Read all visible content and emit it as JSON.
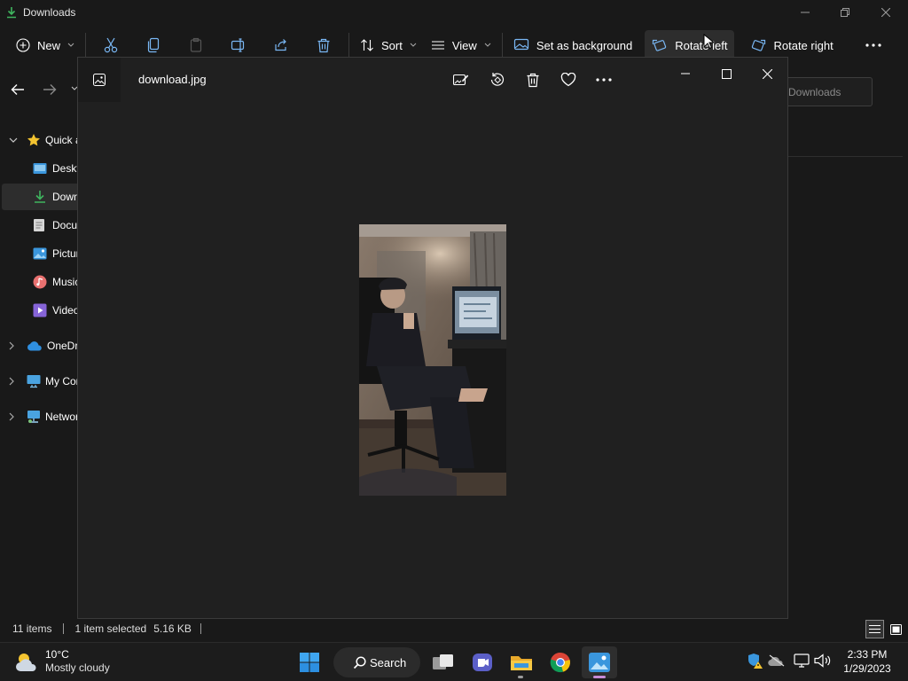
{
  "explorer": {
    "window_title": "Downloads",
    "toolbar": {
      "new_label": "New",
      "sort_label": "Sort",
      "view_label": "View",
      "set_background_label": "Set as background",
      "rotate_left_label": "Rotate left",
      "rotate_right_label": "Rotate right"
    },
    "sidebar": {
      "items": [
        {
          "label": "Quick access",
          "icon": "star-icon"
        },
        {
          "label": "Desktop",
          "icon": "desktop-folder-icon"
        },
        {
          "label": "Downloads",
          "icon": "download-arrow-icon"
        },
        {
          "label": "Documents",
          "icon": "document-icon"
        },
        {
          "label": "Pictures",
          "icon": "pictures-icon"
        },
        {
          "label": "Music",
          "icon": "music-icon"
        },
        {
          "label": "Videos",
          "icon": "videos-icon"
        },
        {
          "label": "OneDrive",
          "icon": "cloud-icon"
        },
        {
          "label": "My Computer",
          "icon": "computer-icon"
        },
        {
          "label": "Network",
          "icon": "network-icon"
        }
      ]
    },
    "search_placeholder": "Downloads",
    "status": {
      "items_count": "11 items",
      "selection": "1 item selected",
      "size": "5.16 KB"
    }
  },
  "photos": {
    "filename": "download.jpg"
  },
  "taskbar": {
    "weather_temp": "10°C",
    "weather_desc": "Mostly cloudy",
    "search_label": "Search",
    "time": "2:33 PM",
    "date": "1/29/2023"
  },
  "colors": {
    "accent": "#0078d4",
    "download_green": "#3fb55f",
    "window_bg": "#191919",
    "viewer_bg": "#202020"
  }
}
